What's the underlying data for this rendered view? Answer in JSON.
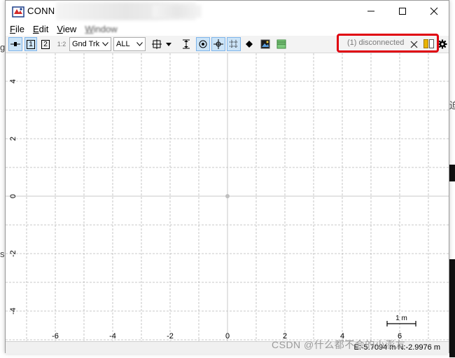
{
  "window": {
    "title": "CONN"
  },
  "menu": [
    "File",
    "Edit",
    "View",
    "Window"
  ],
  "toolbar": {
    "button_1": "1",
    "button_2": "2",
    "button_12": "1:2",
    "mode_select": "Gnd Trk",
    "filter_select": "ALL"
  },
  "status": {
    "connection_text": "(1) disconnected",
    "color_disconnected": "#e0000f"
  },
  "plot": {
    "x_tick_labels": [
      "-6",
      "-4",
      "-2",
      "0",
      "2",
      "4",
      "6"
    ],
    "y_tick_labels": [
      "4",
      "2",
      "0",
      "-2",
      "-4"
    ],
    "scale_label": "1 m",
    "origin_marker_color": "#c0c0c0",
    "grid_color": "#b9b9b9"
  },
  "statusbar": {
    "coordinates": "E:-5.7094 m N:-2.9976 m"
  },
  "watermark": "CSDN @什么都不会的小澎友"
}
